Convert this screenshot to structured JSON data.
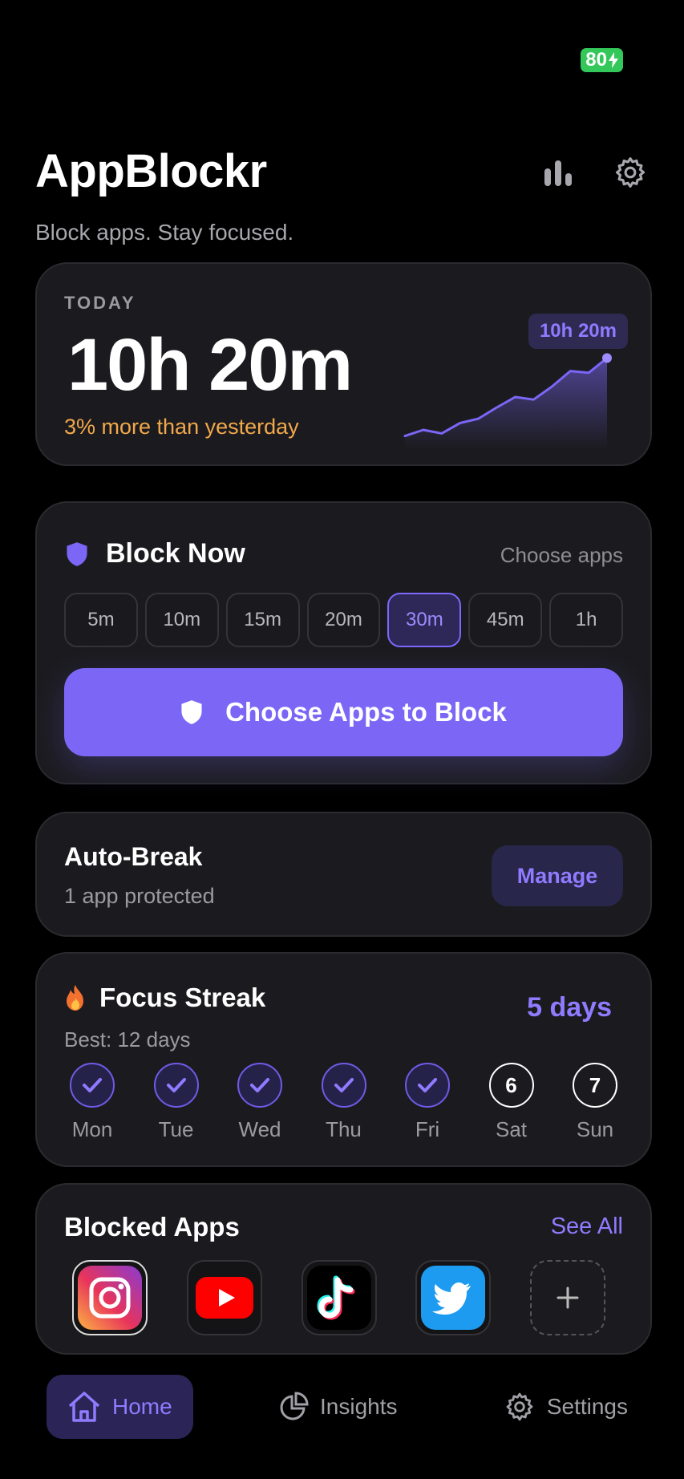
{
  "status": {
    "battery": "80"
  },
  "header": {
    "title": "AppBlockr",
    "subtitle": "Block apps. Stay focused."
  },
  "today": {
    "label": "TODAY",
    "value": "10h 20m",
    "delta": "3% more than yesterday",
    "chart_badge": "10h 20m",
    "trend": [
      0.05,
      0.12,
      0.08,
      0.2,
      0.25,
      0.38,
      0.5,
      0.47,
      0.62,
      0.8,
      0.78,
      0.95
    ],
    "accent": "#7b66f5"
  },
  "block_now": {
    "title": "Block Now",
    "link": "Choose apps",
    "durations": [
      "5m",
      "10m",
      "15m",
      "20m",
      "30m",
      "45m",
      "1h"
    ],
    "selected": "30m",
    "button": "Choose Apps to Block"
  },
  "auto_break": {
    "title": "Auto-Break",
    "subtitle": "1 app protected",
    "button": "Manage"
  },
  "streak": {
    "title": "Focus Streak",
    "best": "Best: 12 days",
    "count": "5 days",
    "days": [
      {
        "label": "Mon",
        "done": true,
        "num": ""
      },
      {
        "label": "Tue",
        "done": true,
        "num": ""
      },
      {
        "label": "Wed",
        "done": true,
        "num": ""
      },
      {
        "label": "Thu",
        "done": true,
        "num": ""
      },
      {
        "label": "Fri",
        "done": true,
        "num": ""
      },
      {
        "label": "Sat",
        "done": false,
        "num": "6"
      },
      {
        "label": "Sun",
        "done": false,
        "num": "7"
      }
    ]
  },
  "blocked_apps": {
    "title": "Blocked Apps",
    "link": "See All",
    "apps": [
      "instagram-icon",
      "youtube-icon",
      "tiktok-icon",
      "twitter-icon"
    ]
  },
  "tabs": [
    {
      "label": "Home",
      "icon": "home-icon",
      "active": true
    },
    {
      "label": "Insights",
      "icon": "pie-chart-icon",
      "active": false
    },
    {
      "label": "Settings",
      "icon": "gear-icon",
      "active": false
    }
  ]
}
